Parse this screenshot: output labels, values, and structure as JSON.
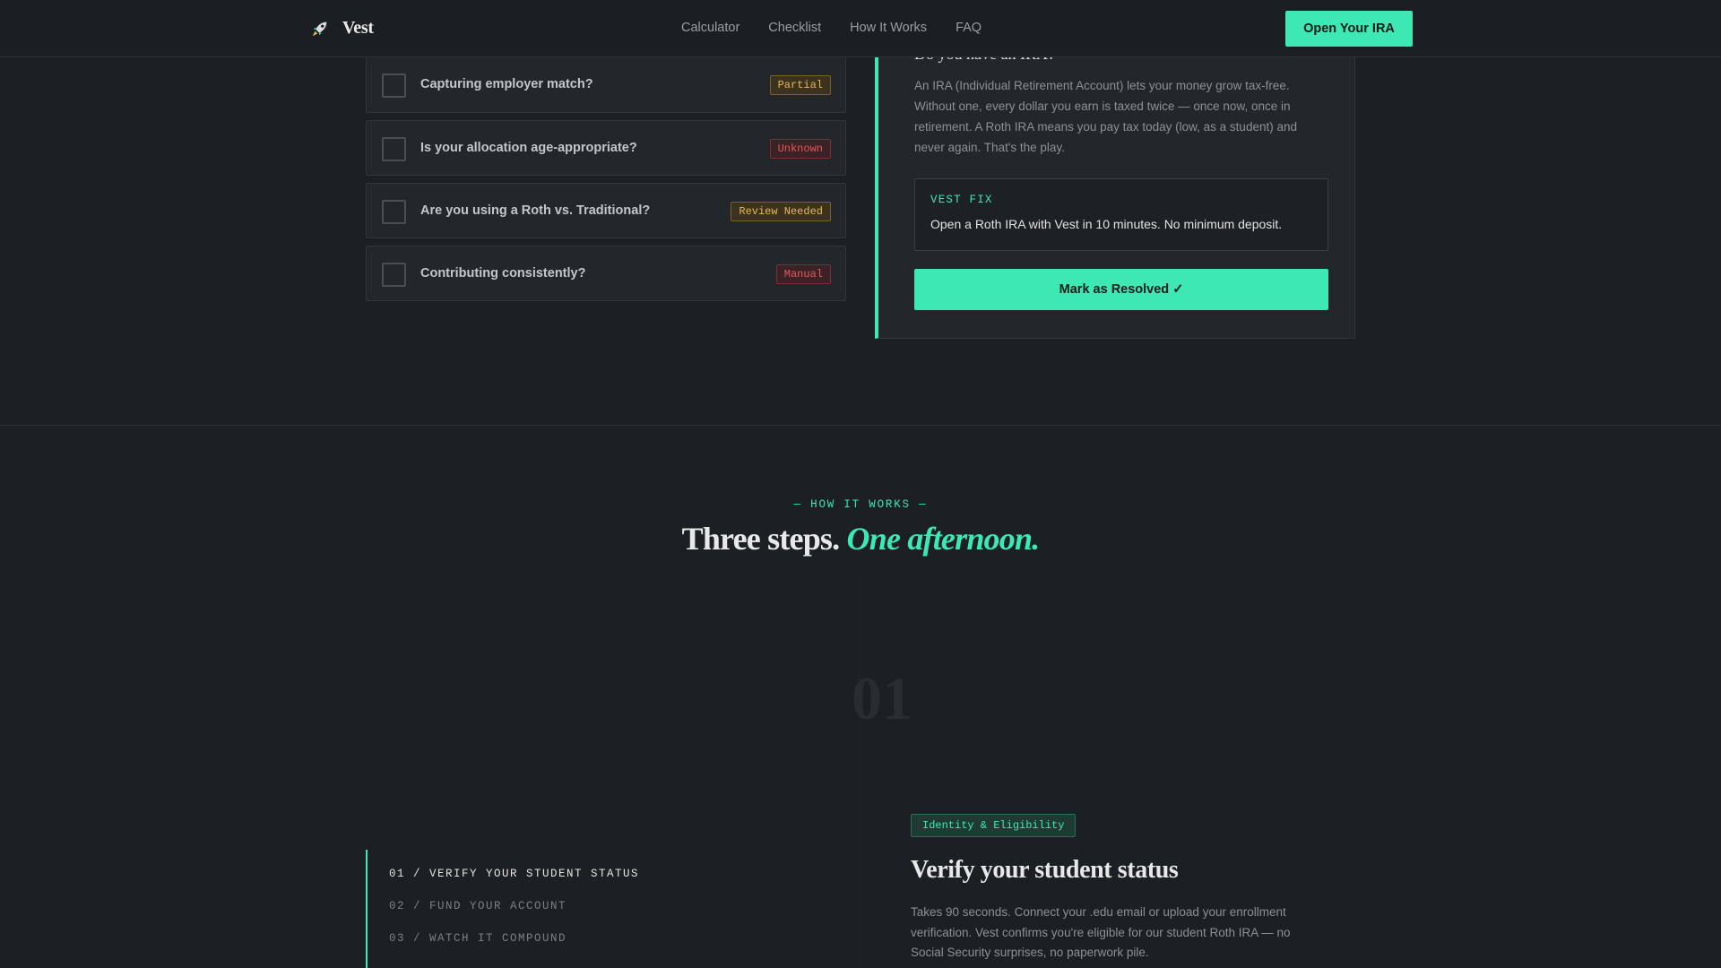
{
  "nav": {
    "brand": "Vest",
    "links": [
      "Calculator",
      "Checklist",
      "How It Works",
      "FAQ"
    ],
    "cta": "Open Your IRA"
  },
  "checklist": {
    "items": [
      {
        "label": "Capturing employer match?",
        "status": "Partial"
      },
      {
        "label": "Is your allocation age-appropriate?",
        "status": "Unknown"
      },
      {
        "label": "Are you using a Roth vs. Traditional?",
        "status": "Review Needed"
      },
      {
        "label": "Contributing consistently?",
        "status": "Manual"
      }
    ]
  },
  "detail": {
    "heading": "Do you have an IRA?",
    "body": "An IRA (Individual Retirement Account) lets your money grow tax-free. Without one, every dollar you earn is taxed twice — once now, once in retirement. A Roth IRA means you pay tax today (low, as a student) and never again. That's the play.",
    "fix_label": "VEST FIX",
    "fix_text": "Open a Roth IRA with Vest in 10 minutes. No minimum deposit.",
    "resolve_button": "Mark as Resolved ✓"
  },
  "how_it_works": {
    "eyebrow": "— HOW IT WORKS —",
    "title_main": "Three steps.",
    "title_accent": "One afternoon.",
    "step_number": "01",
    "steps": [
      "01 / VERIFY YOUR STUDENT STATUS",
      "02 / FUND YOUR ACCOUNT",
      "03 / WATCH IT COMPOUND"
    ],
    "active_step": {
      "tag": "Identity & Eligibility",
      "title": "Verify your student status",
      "description": "Takes 90 seconds. Connect your .edu email or upload your enrollment verification. Vest confirms you're eligible for our student Roth IRA — no Social Security surprises, no paperwork pile."
    }
  },
  "colors": {
    "accent": "#3de8b5",
    "background": "#1c1f23",
    "warning": "#e8b94a",
    "danger": "#e8565a"
  }
}
